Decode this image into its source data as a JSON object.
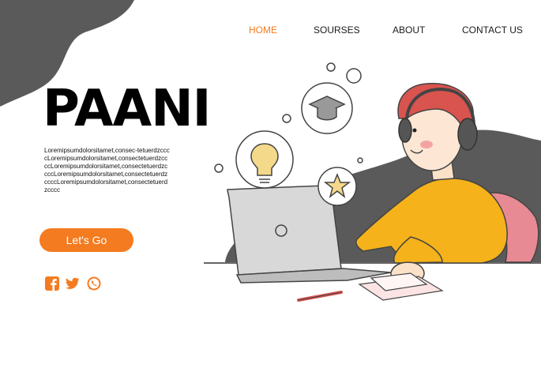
{
  "nav": {
    "items": [
      {
        "label": "HOME",
        "active": true
      },
      {
        "label": "SOURSES",
        "active": false
      },
      {
        "label": "ABOUT",
        "active": false
      },
      {
        "label": "CONTACT US",
        "active": false
      }
    ]
  },
  "hero": {
    "title": "PAANI",
    "description": "Loremipsumdolorsitamet,consec-tetuerdzccccLoremipsumdolorsitamet,consectetuerdzccccLoremipsumdolorsitamet,consectetuerdzccccLoremipsumdolorsitamet,consectetuerdzccccLoremipsumdolorsitamet,consectetuerdzcccc",
    "cta_label": "Let's Go"
  },
  "social": [
    "facebook-icon",
    "twitter-icon",
    "whatsapp-icon"
  ],
  "colors": {
    "accent": "#f47b20",
    "blob": "#5a5a5a",
    "shirt": "#f5b21a",
    "hair": "#d9534f",
    "laptop": "#d8d8d8",
    "chair": "#e88a93"
  }
}
